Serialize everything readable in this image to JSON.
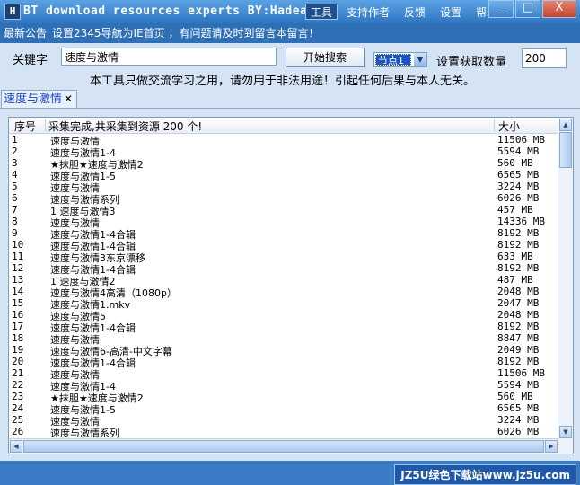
{
  "window": {
    "title": "BT download resources experts BY:Hadean",
    "icon_glyph": "H",
    "controls": {
      "minimize": "_",
      "maximize": "□",
      "close": "X"
    }
  },
  "menu": [
    "工具",
    "支持作者",
    "反馈",
    "设置",
    "帮助"
  ],
  "notice": {
    "label": "最新公告",
    "message": "设置2345导航为IE首页 ，有问题请及时到留言本留言！"
  },
  "search": {
    "keyword_label": "关键字",
    "keyword_value": "速度与激情",
    "search_button": "开始搜索",
    "node_value": "节点1",
    "count_label": "设置获取数量",
    "count_value": "200"
  },
  "disclaimer": "本工具只做交流学习之用，请勿用于非法用途！引起任何后果与本人无关。",
  "tab": {
    "label": "速度与激情",
    "close": "✕"
  },
  "list": {
    "columns": [
      "序号",
      "采集完成,共采集到资源 200 个!",
      "大小"
    ],
    "rows": [
      [
        "1",
        "速度与激情",
        "11506 MB"
      ],
      [
        "2",
        "速度与激情1-4",
        "5594 MB"
      ],
      [
        "3",
        "★抹胆★速度与激情2",
        "560 MB"
      ],
      [
        "4",
        "速度与激情1-5",
        "6565 MB"
      ],
      [
        "5",
        "速度与激情",
        "3224 MB"
      ],
      [
        "6",
        "速度与激情系列",
        "6026 MB"
      ],
      [
        "7",
        "1 速度与激情3",
        "457 MB"
      ],
      [
        "8",
        "速度与激情",
        "14336 MB"
      ],
      [
        "9",
        "速度与激情1-4合辑",
        "8192 MB"
      ],
      [
        "10",
        "速度与激情1-4合辑",
        "8192 MB"
      ],
      [
        "11",
        "速度与激情3东京漂移",
        "633 MB"
      ],
      [
        "12",
        "速度与激情1-4合辑",
        "8192 MB"
      ],
      [
        "13",
        "1 速度与激情2",
        "487 MB"
      ],
      [
        "14",
        "速度与激情4高清（1080p）",
        "2048 MB"
      ],
      [
        "15",
        "速度与激情1.mkv",
        "2047 MB"
      ],
      [
        "16",
        "速度与激情5",
        "2048 MB"
      ],
      [
        "17",
        "速度与激情1-4合辑",
        "8192 MB"
      ],
      [
        "18",
        "速度与激情",
        "8847 MB"
      ],
      [
        "19",
        "速度与激情6-高清-中文字幕",
        "2049 MB"
      ],
      [
        "20",
        "速度与激情1-4合辑",
        "8192 MB"
      ],
      [
        "21",
        "速度与激情",
        "11506 MB"
      ],
      [
        "22",
        "速度与激情1-4",
        "5594 MB"
      ],
      [
        "23",
        "★抹胆★速度与激情2",
        "560 MB"
      ],
      [
        "24",
        "速度与激情1-5",
        "6565 MB"
      ],
      [
        "25",
        "速度与激情",
        "3224 MB"
      ],
      [
        "26",
        "速度与激情系列",
        "6026 MB"
      ]
    ]
  },
  "watermark": "JZ5U绿色下载站www.jz5u.com"
}
